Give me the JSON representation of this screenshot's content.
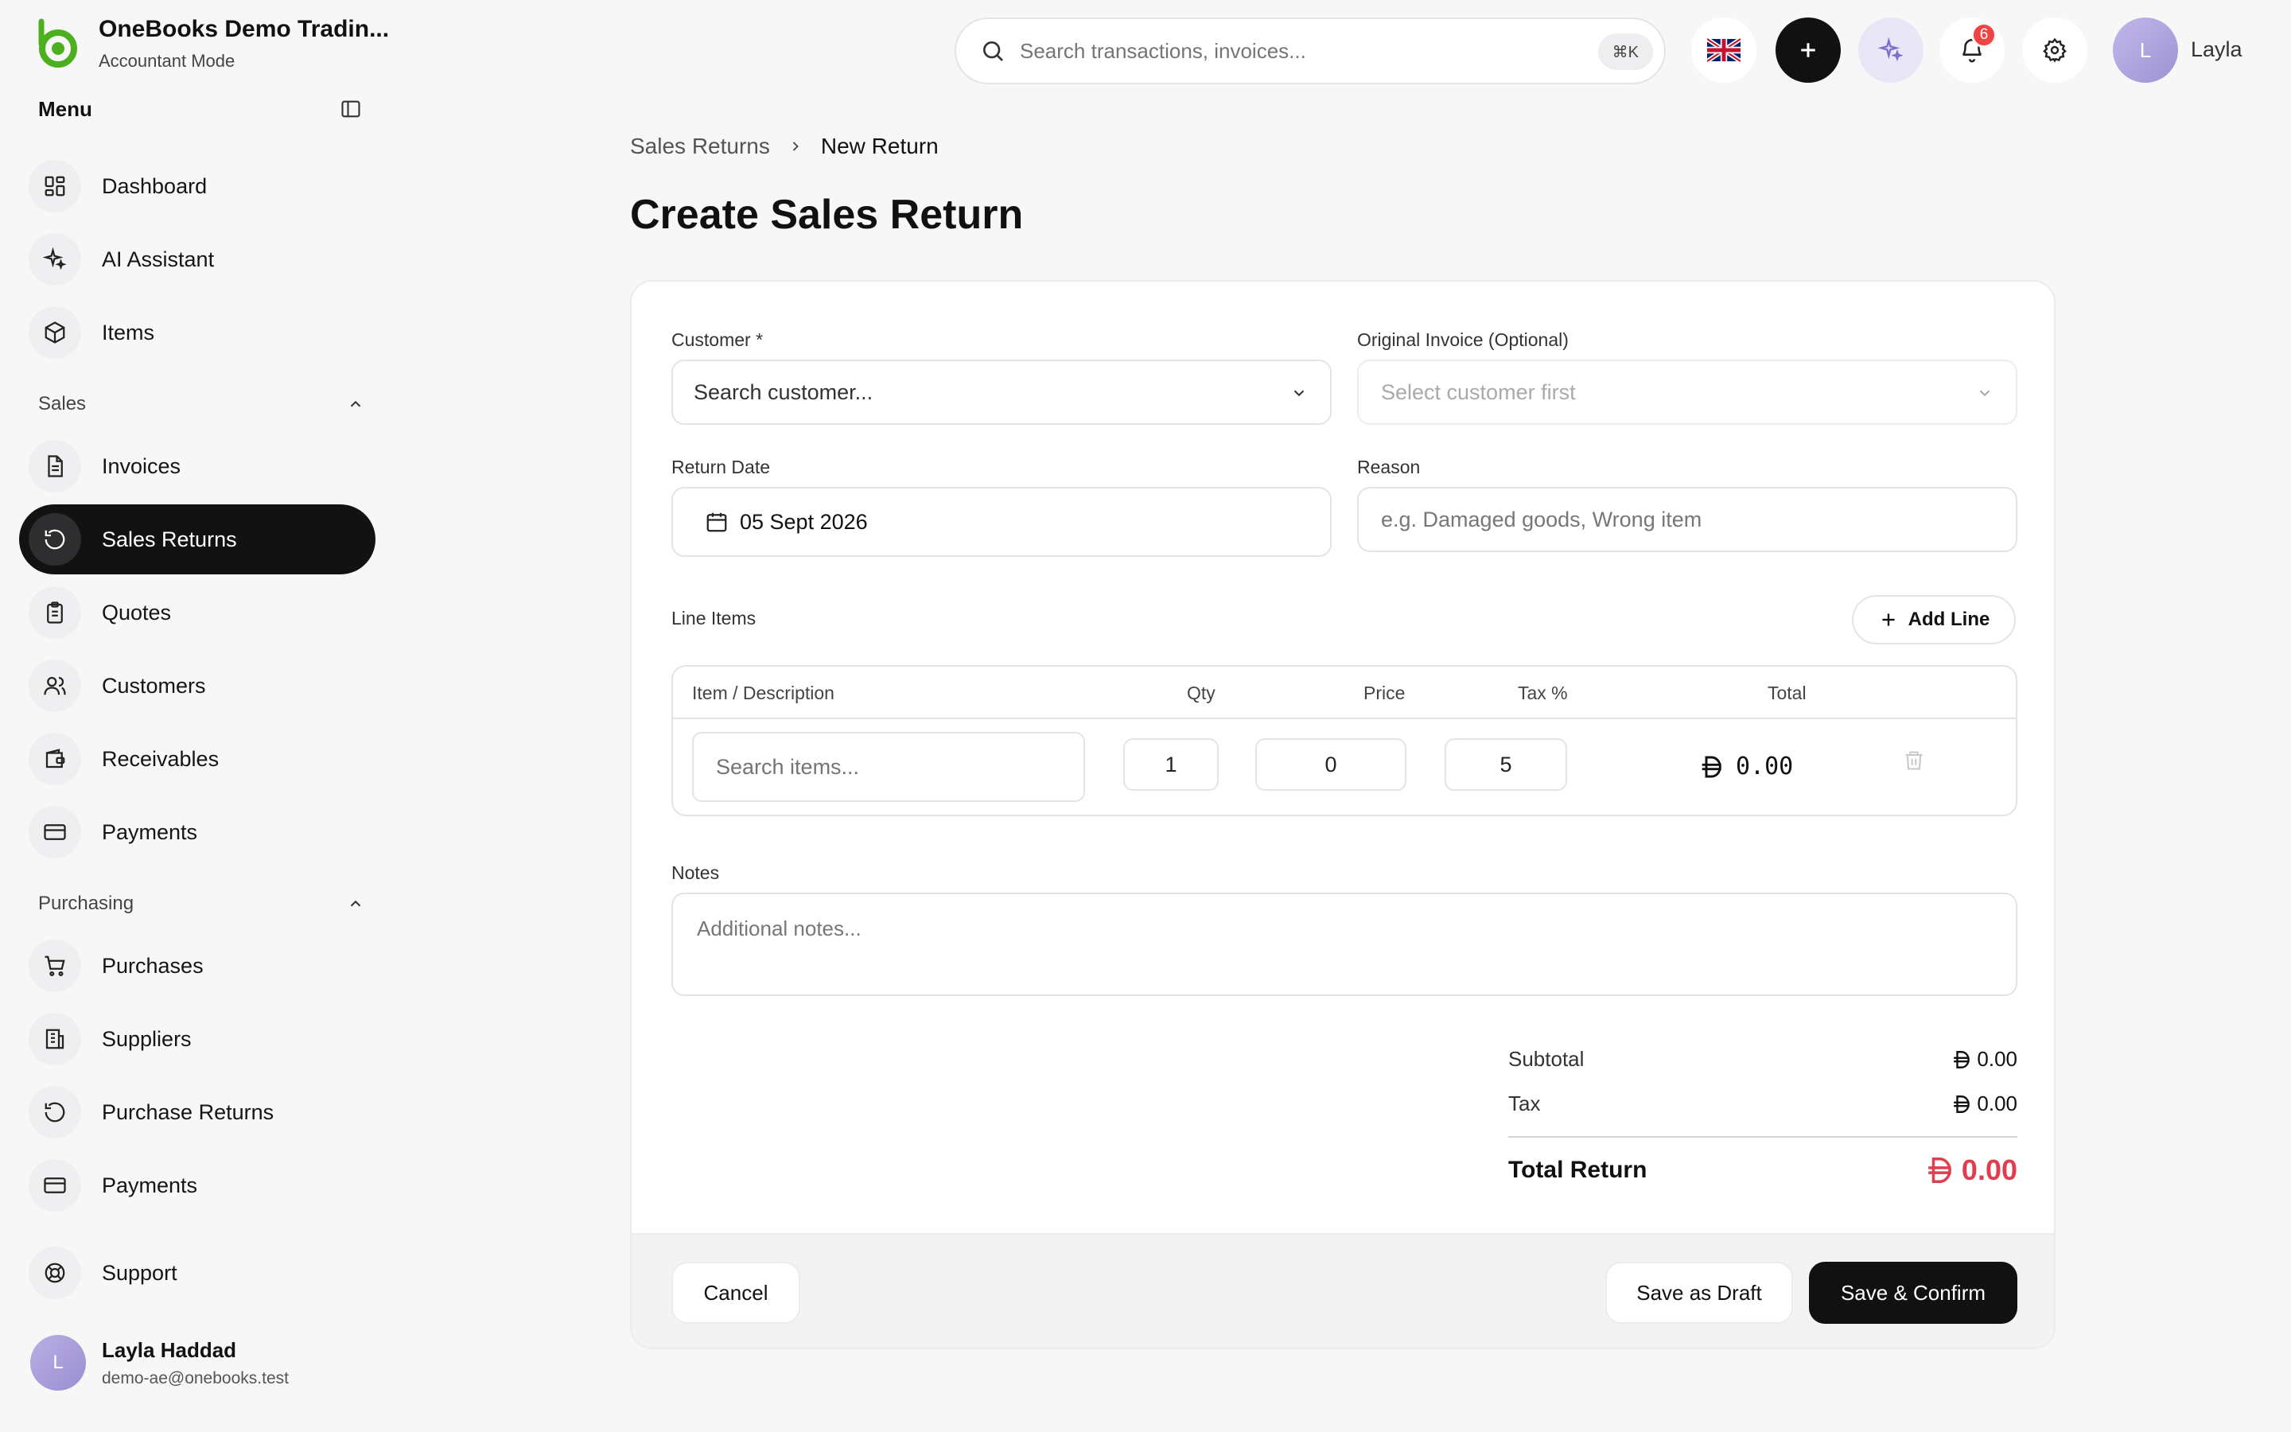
{
  "app": {
    "name": "OneBooks Demo Tradin...",
    "mode": "Accountant Mode"
  },
  "sidebar": {
    "menu_label": "Menu",
    "items_top": [
      {
        "label": "Dashboard",
        "icon": "dashboard-icon"
      },
      {
        "label": "AI Assistant",
        "icon": "sparkles-icon"
      },
      {
        "label": "Items",
        "icon": "box-icon"
      }
    ],
    "sales": {
      "label": "Sales",
      "items": [
        {
          "label": "Invoices",
          "icon": "invoice-icon"
        },
        {
          "label": "Sales Returns",
          "icon": "return-icon",
          "active": true
        },
        {
          "label": "Quotes",
          "icon": "clipboard-icon"
        },
        {
          "label": "Customers",
          "icon": "users-icon"
        },
        {
          "label": "Receivables",
          "icon": "wallet-icon"
        },
        {
          "label": "Payments",
          "icon": "card-icon"
        }
      ]
    },
    "purchasing": {
      "label": "Purchasing",
      "items": [
        {
          "label": "Purchases",
          "icon": "cart-icon"
        },
        {
          "label": "Suppliers",
          "icon": "building-icon"
        },
        {
          "label": "Purchase Returns",
          "icon": "return-icon"
        },
        {
          "label": "Payments",
          "icon": "card-icon"
        }
      ]
    },
    "support_label": "Support",
    "user": {
      "initial": "L",
      "name": "Layla Haddad",
      "email": "demo-ae@onebooks.test"
    }
  },
  "topbar": {
    "search_placeholder": "Search transactions, invoices...",
    "shortcut": "⌘K",
    "notification_count": "6",
    "user_initial": "L",
    "user_name": "Layla"
  },
  "breadcrumb": {
    "parent": "Sales Returns",
    "current": "New Return"
  },
  "page_title": "Create Sales Return",
  "form": {
    "customer_label": "Customer *",
    "customer_placeholder": "Search customer...",
    "invoice_label": "Original Invoice (Optional)",
    "invoice_placeholder": "Select customer first",
    "date_label": "Return Date",
    "date_value": "05 Sept 2026",
    "reason_label": "Reason",
    "reason_placeholder": "e.g. Damaged goods, Wrong item",
    "line_items_label": "Line Items",
    "add_line_label": "Add Line",
    "columns": [
      "Item / Description",
      "Qty",
      "Price",
      "Tax %",
      "Total"
    ],
    "line": {
      "item_placeholder": "Search items...",
      "qty": "1",
      "price": "0",
      "tax": "5",
      "total": "0.00"
    },
    "notes_label": "Notes",
    "notes_placeholder": "Additional notes..."
  },
  "summary": {
    "subtotal_label": "Subtotal",
    "subtotal": "0.00",
    "tax_label": "Tax",
    "tax": "0.00",
    "total_label": "Total Return",
    "total": "0.00"
  },
  "actions": {
    "cancel": "Cancel",
    "draft": "Save as Draft",
    "confirm": "Save & Confirm"
  },
  "colors": {
    "brand": "#4caf1e",
    "active_nav": "#121212",
    "total_accent": "#e03d4f",
    "badge": "#ef4444"
  }
}
